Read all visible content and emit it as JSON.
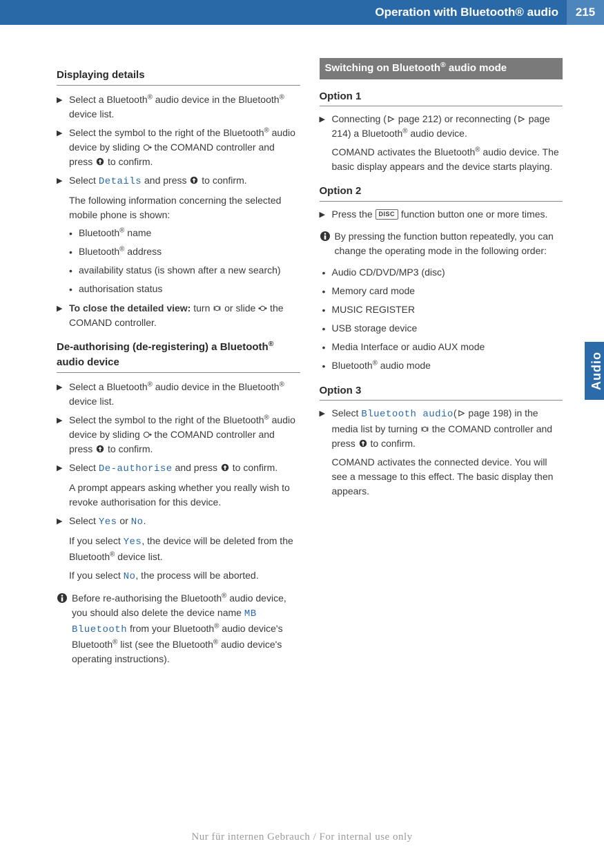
{
  "header": {
    "title": "Operation with Bluetooth® audio",
    "page": "215"
  },
  "sideTab": "Audio",
  "left": {
    "h1": "Displaying details",
    "s1a": "Select a Bluetooth",
    "s1b": " audio device in the Bluetooth",
    "s1c": " device list.",
    "s2a": "Select the symbol to the right of the Blue­tooth",
    "s2b": " audio device by sliding ",
    "s2c": " the COMAND controller and press ",
    "s2d": " to con­firm.",
    "s3a": "Select ",
    "s3ui": "Details",
    "s3b": " and press ",
    "s3c": " to confirm.",
    "s3f": "The following information concerning the selected mobile phone is shown:",
    "b1a": "Bluetooth",
    "b1b": " name",
    "b2a": "Bluetooth",
    "b2b": " address",
    "b3": "availability status (is shown after a new search)",
    "b4": "authorisation status",
    "s4a": "To close the detailed view:",
    "s4b": " turn ",
    "s4c": " or slide ",
    "s4d": " the COMAND controller.",
    "h2": "De-authorising (de-registering) a Blue­tooth® audio device",
    "d1a": "Select a Bluetooth",
    "d1b": " audio device in the Bluetooth",
    "d1c": " device list.",
    "d2a": "Select the symbol to the right of the Blue­tooth",
    "d2b": " audio device by sliding ",
    "d2c": " the COMAND controller and press ",
    "d2d": " to con­firm.",
    "d3a": "Select ",
    "d3ui": "De-authorise",
    "d3b": " and press ",
    "d3c": " to con­firm.",
    "d3f": "A prompt appears asking whether you really wish to revoke authorisation for this device.",
    "d4a": "Select ",
    "d4yes": "Yes",
    "d4b": " or ",
    "d4no": "No",
    "d4c": ".",
    "d4f1a": "If you select ",
    "d4f1b": ", the device will be deleted from the Bluetooth",
    "d4f1c": " device list.",
    "d4f2a": "If you select ",
    "d4f2b": ", the process will be aborted.",
    "i1a": "Before re-authorising the Bluetooth",
    "i1b": " audio device, you should also delete the device name ",
    "i1ui": "MB Bluetooth",
    "i1c": " from your Bluetooth",
    "i1d": " audio device's Bluetooth",
    "i1e": " list (see the Bluetooth",
    "i1f": " audio device's operat­ing instructions)."
  },
  "right": {
    "hbar": "Switching on Bluetooth® audio mode",
    "o1": "Option 1",
    "o1sa": "Connecting (",
    "o1sb": " page 212) or reconnecting (",
    "o1sc": " page 214) a Bluetooth",
    "o1sd": " audio device.",
    "o1f": "COMAND activates the Bluetooth® audio device. The basic display appears and the device starts playing.",
    "o1fa": "COMAND activates the Bluetooth",
    "o1fb": " audio device. The basic display appears and the device starts playing.",
    "o2": "Option 2",
    "o2sa": "Press the ",
    "o2key": "DISC",
    "o2sb": " function button one or more times.",
    "o2i": "By pressing the function button repeat­edly, you can change the operating mode in the following order:",
    "ob1": "Audio CD/DVD/MP3 (disc)",
    "ob2": "Memory card mode",
    "ob3": "MUSIC REGISTER",
    "ob4": "USB storage device",
    "ob5": "Media Interface or audio AUX mode",
    "ob6a": "Bluetooth",
    "ob6b": " audio mode",
    "o3": "Option 3",
    "o3sa": "Select ",
    "o3ui": "Bluetooth audio",
    "o3sb": "(",
    "o3sc": " page 198) in the media list by turning ",
    "o3sd": " the COMAND controller and press ",
    "o3se": " to confirm.",
    "o3f": "COMAND activates the connected device. You will see a message to this effect. The basic display then appears."
  },
  "reg": "®",
  "footer": "Nur für internen Gebrauch / For internal use only"
}
